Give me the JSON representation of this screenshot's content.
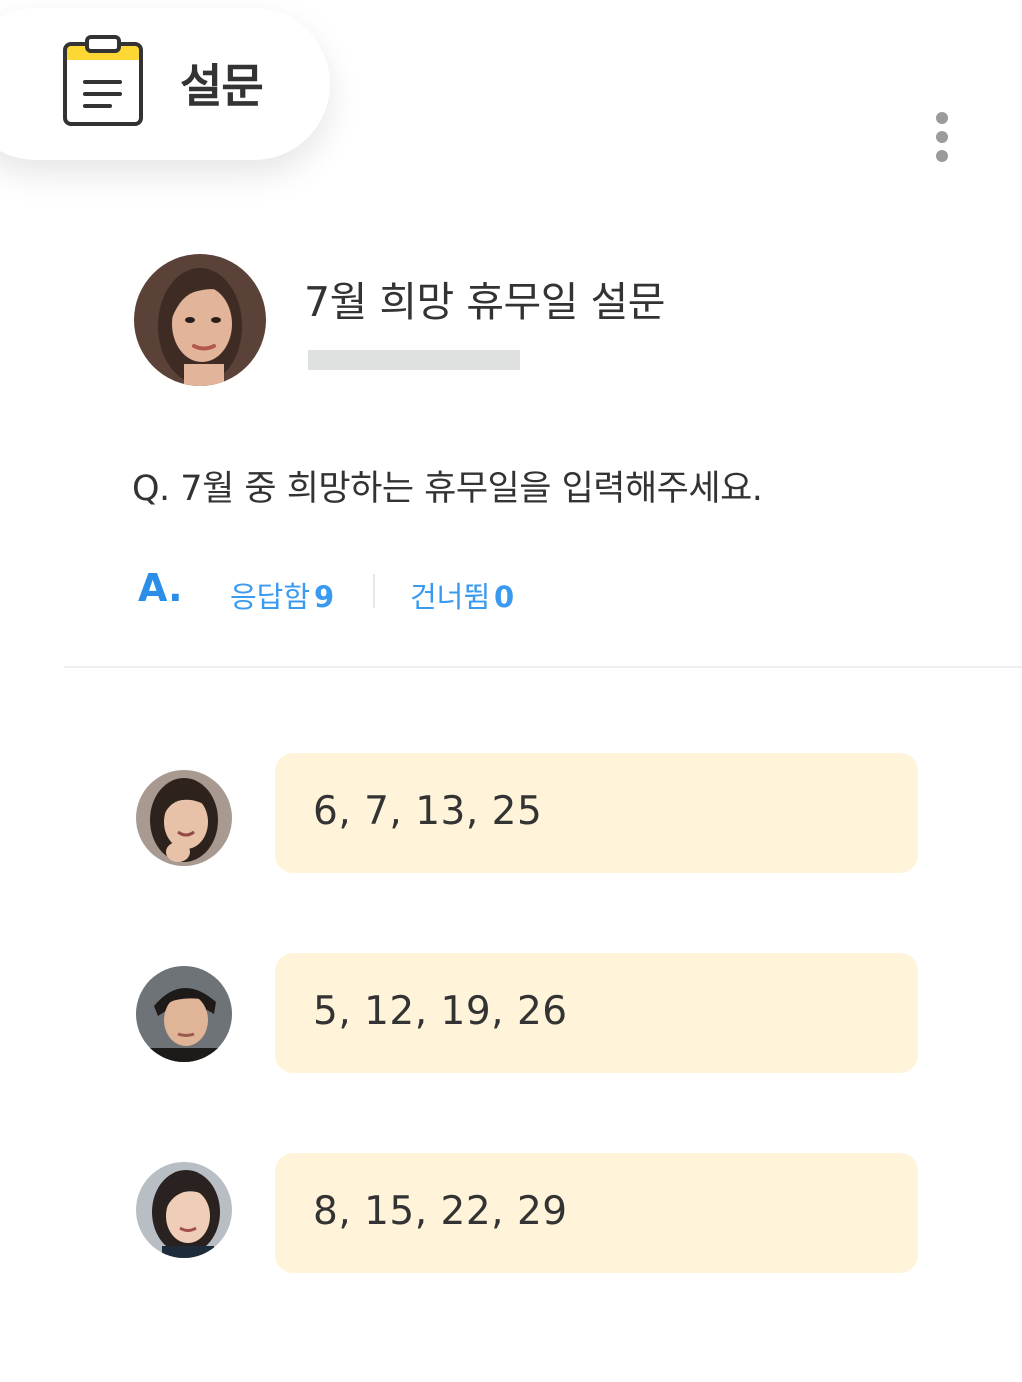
{
  "header": {
    "title": "설문",
    "icon": "clipboard-icon",
    "menu_icon": "more-vertical-icon"
  },
  "survey": {
    "title": "7월 희망 휴무일 설문",
    "question": "Q. 7월 중 희망하는 휴무일을 입력해주세요."
  },
  "answers": {
    "label": "A.",
    "responded_label": "응답함",
    "responded_count": "9",
    "skipped_label": "건너뜀",
    "skipped_count": "0"
  },
  "responses": [
    {
      "text": "6, 7, 13, 25"
    },
    {
      "text": "5, 12, 19, 26"
    },
    {
      "text": "8, 15, 22, 29"
    }
  ],
  "colors": {
    "accent": "#2b8ee8",
    "bubble": "#fff4d9",
    "icon_yellow": "#fdd835",
    "divider": "#eeeeee"
  }
}
